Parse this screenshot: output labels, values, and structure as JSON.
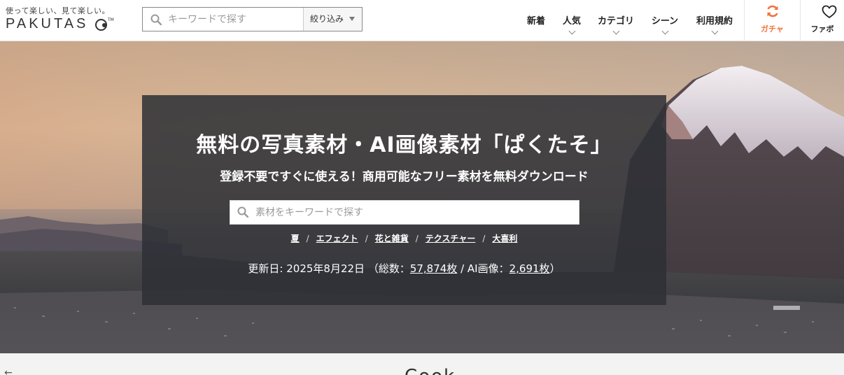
{
  "logo": {
    "tagline": "使って楽しい、見て楽しい。",
    "wordmark": "PAKUTAS",
    "tm": "TM"
  },
  "header_search": {
    "placeholder": "キーワードで探す",
    "filter_label": "絞り込み"
  },
  "nav": [
    {
      "label": "新着",
      "has_dropdown": false
    },
    {
      "label": "人気",
      "has_dropdown": true
    },
    {
      "label": "カテゴリ",
      "has_dropdown": true
    },
    {
      "label": "シーン",
      "has_dropdown": true
    },
    {
      "label": "利用規約",
      "has_dropdown": true
    }
  ],
  "gacha": {
    "label": "ガチャ",
    "icon": "refresh-icon",
    "color": "#f0743e"
  },
  "favorite": {
    "label": "ファボ",
    "icon": "heart-icon"
  },
  "hero": {
    "title": "無料の写真素材・AI画像素材「ぱくたそ」",
    "subtitle": "登録不要ですぐに使える！商用可能なフリー素材を無料ダウンロード",
    "search_placeholder": "素材をキーワードで探す",
    "tags": [
      "夏",
      "エフェクト",
      "花と雑貨",
      "テクスチャー",
      "大喜利"
    ],
    "tag_separator": "/",
    "update": {
      "prefix": "更新日: 2025年8月22日 （総数：",
      "total": "57,874枚",
      "ai_prefix": " / AI画像：",
      "ai_total": "2,691枚",
      "suffix": "）"
    }
  },
  "strip": {
    "arrow": "←",
    "text": "... Cook"
  }
}
